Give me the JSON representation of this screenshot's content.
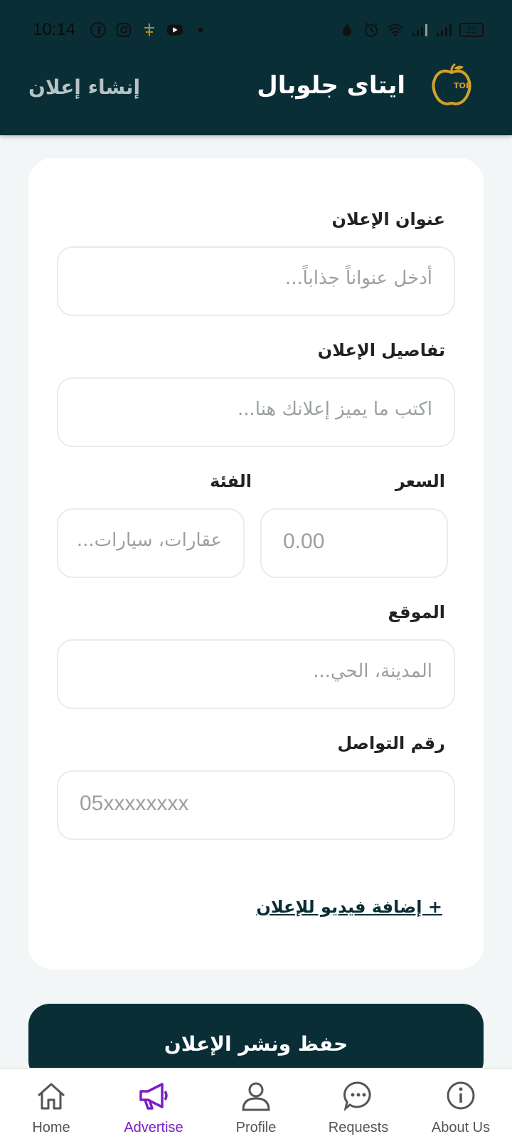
{
  "status_bar": {
    "time": "10:14",
    "left_icons": [
      "facebook-icon",
      "instagram-icon",
      "app-icon",
      "youtube-icon",
      "dot-icon"
    ],
    "right_icons": [
      "data-saver-icon",
      "alarm-icon",
      "wifi-icon",
      "signal-icon",
      "signal-icon"
    ],
    "battery": "21"
  },
  "header": {
    "app_title": "ايتاى جلوبال",
    "page_action": "إنشاء إعلان",
    "logo": "apple-logo-icon"
  },
  "form": {
    "title_label": "عنوان الإعلان",
    "title_placeholder": "أدخل عنواناً جذاباً...",
    "details_label": "تفاصيل الإعلان",
    "details_placeholder": "اكتب ما يميز إعلانك هنا...",
    "price_label": "السعر",
    "price_placeholder": "0.00",
    "category_label": "الفئة",
    "category_placeholder": "عقارات، سيارات...",
    "location_label": "الموقع",
    "location_placeholder": "المدينة، الحي...",
    "phone_label": "رقم التواصل",
    "phone_placeholder": "05xxxxxxxx",
    "add_video_label": "+ إضافة فيديو للإعلان"
  },
  "submit_label": "حفظ ونشر الإعلان",
  "bottom_nav": {
    "items": [
      {
        "label": "Home",
        "icon": "home-icon"
      },
      {
        "label": "Advertise",
        "icon": "megaphone-icon",
        "active": true
      },
      {
        "label": "Profile",
        "icon": "person-icon"
      },
      {
        "label": "Requests",
        "icon": "chat-icon"
      },
      {
        "label": "About Us",
        "icon": "info-icon"
      }
    ]
  },
  "colors": {
    "primary": "#0a2e36",
    "active_nav": "#7a1fc6",
    "background": "#f2f6f6"
  }
}
